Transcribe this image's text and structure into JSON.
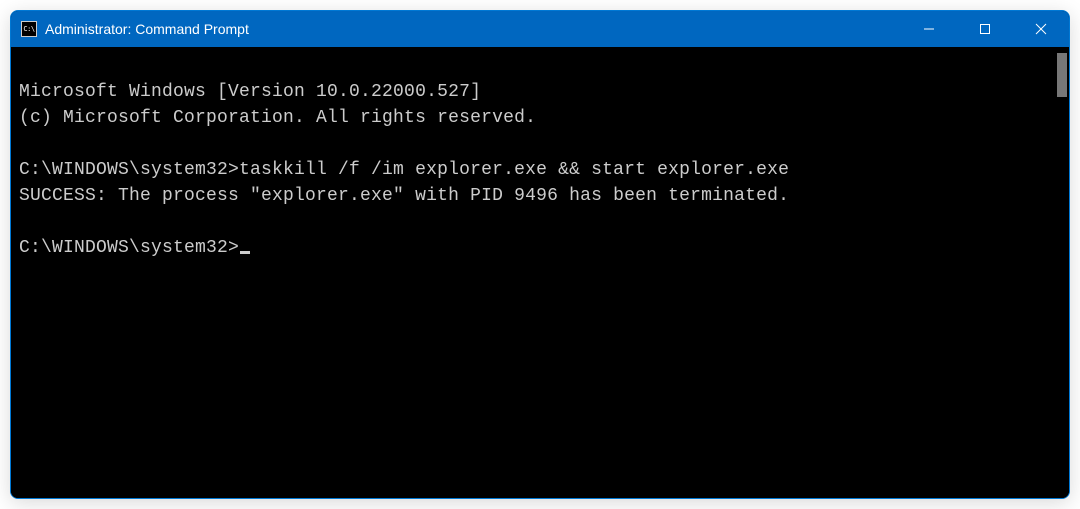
{
  "window": {
    "title": "Administrator: Command Prompt"
  },
  "terminal": {
    "lines": [
      "Microsoft Windows [Version 10.0.22000.527]",
      "(c) Microsoft Corporation. All rights reserved.",
      "",
      "C:\\WINDOWS\\system32>taskkill /f /im explorer.exe && start explorer.exe",
      "SUCCESS: The process \"explorer.exe\" with PID 9496 has been terminated.",
      ""
    ],
    "prompt": "C:\\WINDOWS\\system32>"
  }
}
